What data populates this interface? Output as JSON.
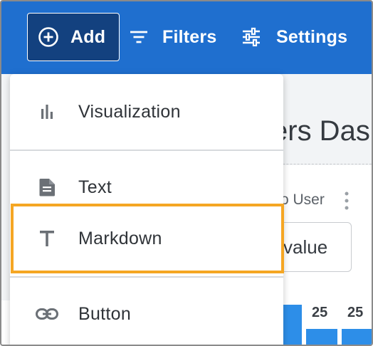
{
  "toolbar": {
    "add_label": "Add",
    "filters_label": "Filters",
    "settings_label": "Settings",
    "bg_color": "#1f6fcf",
    "active_button_color": "#13417f"
  },
  "menu": {
    "items": [
      {
        "label": "Visualization",
        "icon": "bar-chart-icon"
      },
      {
        "label": "Text",
        "icon": "document-icon"
      },
      {
        "label": "Markdown",
        "icon": "text-t-icon"
      },
      {
        "label": "Button",
        "icon": "link-icon"
      }
    ],
    "highlighted_item": "Markdown",
    "highlight_color": "#f5a623"
  },
  "background": {
    "dashboard_title_fragment": "ers Das",
    "filter_label_fragment": "o User",
    "input_value_fragment": "value",
    "bar_values": [
      "25",
      "25"
    ],
    "bar_color": "#2d8ee8"
  }
}
